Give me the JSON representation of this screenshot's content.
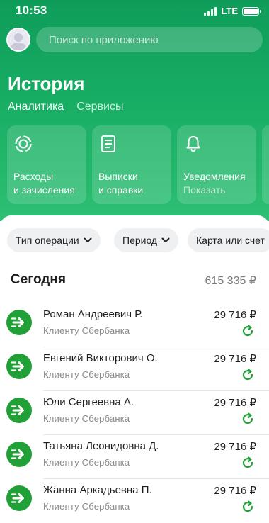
{
  "status_bar": {
    "time": "10:53",
    "network": "LTE"
  },
  "search": {
    "placeholder": "Поиск по приложению"
  },
  "header": {
    "title": "История"
  },
  "subnav": [
    {
      "label": "Аналитика"
    },
    {
      "label": "Сервисы"
    }
  ],
  "tiles": [
    {
      "line1": "Расходы",
      "line2": "и зачисления",
      "icon": "donut-chart-icon"
    },
    {
      "line1": "Выписки",
      "line2": "и справки",
      "icon": "document-list-icon"
    },
    {
      "line1": "Уведомления",
      "line2": "Показать",
      "icon": "bell-icon"
    }
  ],
  "filters": [
    {
      "label": "Тип операции"
    },
    {
      "label": "Период"
    },
    {
      "label": "Карта или счет"
    }
  ],
  "section": {
    "title": "Сегодня",
    "total": "615 335 ₽"
  },
  "transactions": [
    {
      "name": "Роман Андреевич Р.",
      "description": "Клиенту Сбербанка",
      "amount": "29 716 ₽"
    },
    {
      "name": "Евгений Викторович О.",
      "description": "Клиенту Сбербанка",
      "amount": "29 716 ₽"
    },
    {
      "name": "Юли Сергеевна А.",
      "description": "Клиенту Сбербанка",
      "amount": "29 716 ₽"
    },
    {
      "name": "Татьяна Леонидовна Д.",
      "description": "Клиенту Сбербанка",
      "amount": "29 716 ₽"
    },
    {
      "name": "Жанна Аркадьевна П.",
      "description": "Клиенту Сбербанка",
      "amount": "29 716 ₽"
    }
  ],
  "colors": {
    "brand_green": "#21a038",
    "hero_green": "#17ad63",
    "repeat_icon": "#21a038"
  }
}
